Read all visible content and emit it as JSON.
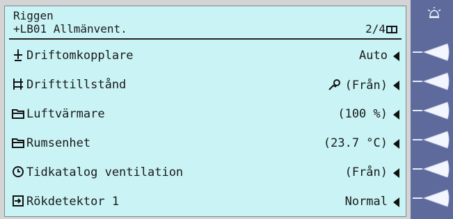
{
  "header": {
    "title": "Riggen",
    "subtitle": "+LB01 Allmänvent.",
    "page": "2/4"
  },
  "rows": [
    {
      "label": "Driftomkopplare",
      "value": "Auto",
      "icon": "selector-switch-icon"
    },
    {
      "label": "Drifttillstånd",
      "value": "(Från)",
      "icon": "operating-state-icon",
      "value_icon": "fan-hand-icon"
    },
    {
      "label": "Luftvärmare",
      "value": "(100 %)",
      "icon": "folder-icon"
    },
    {
      "label": "Rumsenhet",
      "value": "(23.7 °C)",
      "icon": "folder-icon"
    },
    {
      "label": "Tidkatalog ventilation",
      "value": "(Från)",
      "icon": "clock-icon"
    },
    {
      "label": "Rökdetektor 1",
      "value": "Normal",
      "icon": "input-icon"
    }
  ],
  "sidebar": {
    "top_icon": "alarm-bell-icon",
    "softkey_icon": "left-arrow-softkey-icon"
  }
}
